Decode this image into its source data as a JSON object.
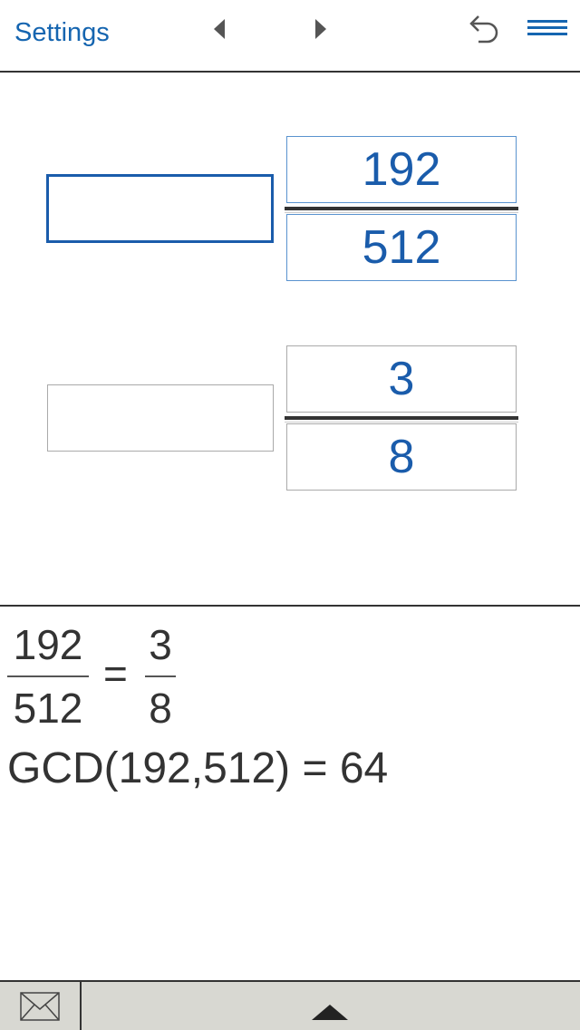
{
  "header": {
    "settings_label": "Settings",
    "prev_icon": "triangle-left-icon",
    "next_icon": "triangle-right-icon",
    "undo_icon": "undo-arrow-icon",
    "menu_icon": "hamburger-menu-icon"
  },
  "input": {
    "original": {
      "whole": "",
      "numerator": "192",
      "denominator": "512"
    },
    "reduced": {
      "whole": "",
      "numerator": "3",
      "denominator": "8"
    }
  },
  "result": {
    "left": {
      "numerator": "192",
      "denominator": "512"
    },
    "equals": "=",
    "right": {
      "numerator": "3",
      "denominator": "8"
    },
    "gcd_text": "GCD(192,512) = 64"
  },
  "footer": {
    "mail_icon": "envelope-icon",
    "expand_icon": "triangle-up-icon"
  },
  "colors": {
    "accent": "#1a5cab",
    "text": "#333333",
    "footer_bg": "#d8d8d2"
  }
}
